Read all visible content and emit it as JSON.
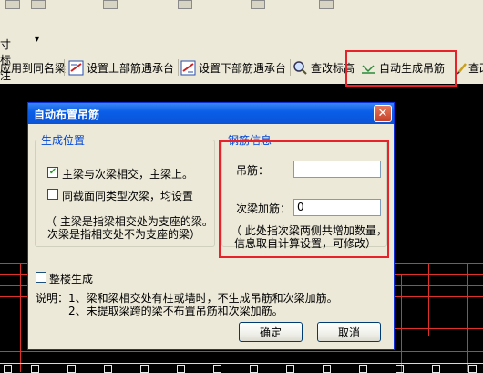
{
  "toolbar": {
    "annotation_label": "寸标注",
    "dropdown_arrow": "▾",
    "buttons": [
      {
        "label": "应用到同名梁",
        "icon": "apply-icon"
      },
      {
        "label": "设置上部筋遇承台",
        "icon": "set-top-rebar-icon"
      },
      {
        "label": "设置下部筋遇承台",
        "icon": "set-bottom-rebar-icon"
      },
      {
        "label": "查改标高",
        "icon": "query-elevation-icon"
      },
      {
        "label": "自动生成吊筋",
        "icon": "auto-hanger-icon"
      },
      {
        "label": "查改",
        "icon": "edit-icon"
      }
    ]
  },
  "dialog": {
    "title": "自动布置吊筋",
    "close_glyph": "✕",
    "gen_position": {
      "legend": "生成位置",
      "option1": {
        "label": "主梁与次梁相交，主梁上。",
        "checked": true
      },
      "option2": {
        "label": "同截面同类型次梁，均设置",
        "checked": false
      },
      "note_line1": "（ 主梁是指梁相交处为支座的梁。",
      "note_line2": "次梁是指相交处不为支座的梁）"
    },
    "rebar_info": {
      "legend": "钢筋信息",
      "hanger_label": "吊筋：",
      "hanger_value": "",
      "secondary_label": "次梁加筋：",
      "secondary_value": "0",
      "note_line1": "（ 此处指次梁两侧共增加数量，",
      "note_line2": "信息取自计算设置，可修改）"
    },
    "whole_floor": {
      "label": "整楼生成",
      "checked": false
    },
    "explanation_line1": "说明：1、梁和梁相交处有柱或墙时，不生成吊筋和次梁加筋。",
    "explanation_line2": "2、未提取梁跨的梁不布置吊筋和次梁加筋。",
    "ok_label": "确定",
    "cancel_label": "取消"
  },
  "colors": {
    "highlight": "#e8212a",
    "title_bar": "#0b54d6",
    "legend_text": "#0046d5"
  }
}
